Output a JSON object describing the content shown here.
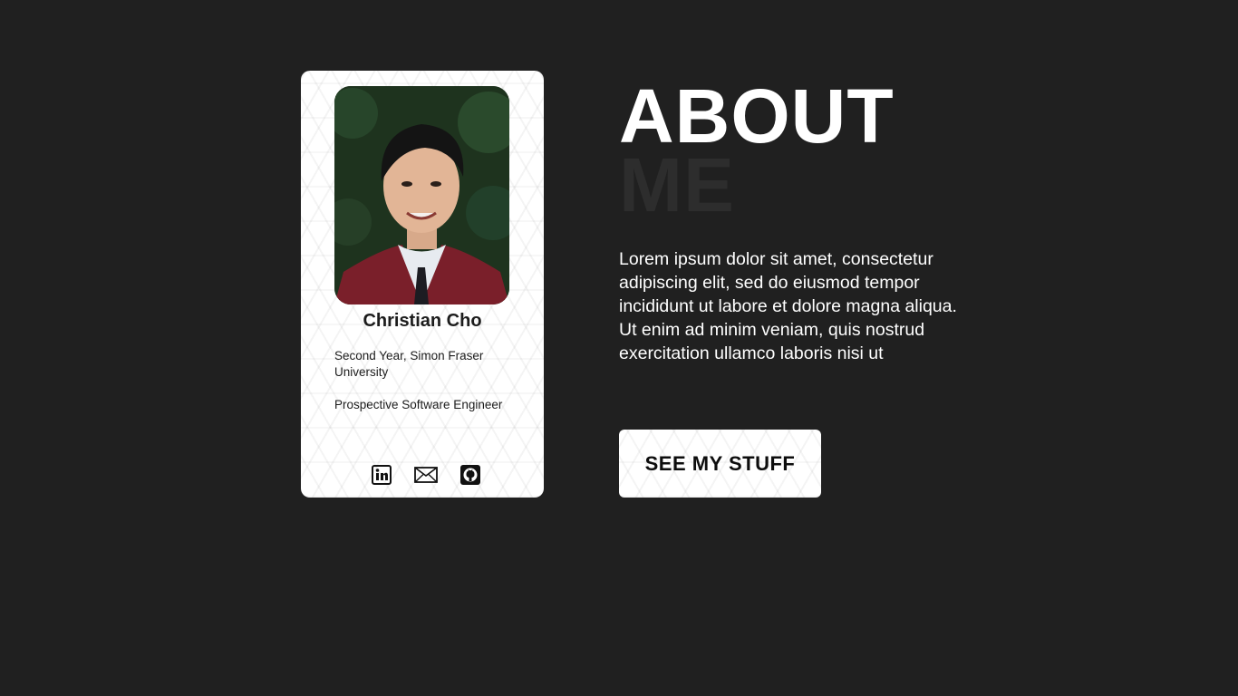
{
  "profile": {
    "name": "Christian Cho",
    "subtitle": "Second Year, Simon Fraser University",
    "role": "Prospective Software Engineer",
    "photo_alt": "Portrait photo",
    "socials": [
      {
        "name": "linkedin-icon"
      },
      {
        "name": "mail-icon"
      },
      {
        "name": "github-icon"
      }
    ]
  },
  "heading": {
    "line1": "ABOUT",
    "line2": "ME"
  },
  "bio": "Lorem ipsum dolor sit amet, consectetur adipiscing elit, sed do eiusmod tempor incididunt ut labore et dolore magna aliqua. Ut enim ad minim veniam, quis nostrud exercitation ullamco laboris nisi ut",
  "cta": {
    "label": "SEE MY STUFF"
  },
  "colors": {
    "background": "#202020",
    "card": "#ffffff",
    "heading_primary": "#ffffff",
    "heading_secondary": "#2d2d2d",
    "text_dark": "#1c1c1c"
  }
}
